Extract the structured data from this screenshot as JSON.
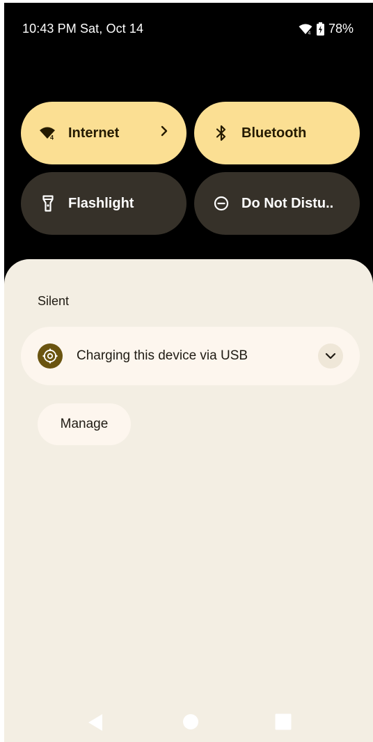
{
  "status_bar": {
    "time_date": "10:43 PM Sat, Oct 14",
    "battery_percent": "78%",
    "icons": [
      "wifi-icon",
      "battery-charging-icon"
    ]
  },
  "quick_settings": {
    "tiles": [
      {
        "label": "Internet",
        "icon": "wifi-icon",
        "state": "on",
        "has_chevron": true
      },
      {
        "label": "Bluetooth",
        "icon": "bluetooth-icon",
        "state": "on"
      },
      {
        "label": "Flashlight",
        "icon": "flashlight-icon",
        "state": "off"
      },
      {
        "label": "Do Not Distu..",
        "icon": "do-not-disturb-icon",
        "state": "off"
      }
    ]
  },
  "notifications": {
    "section_label": "Silent",
    "items": [
      {
        "title": "Charging this device via USB",
        "icon": "settings-gear-icon",
        "expand_icon": "chevron-down-icon"
      }
    ],
    "manage_label": "Manage"
  },
  "navigation": {
    "icons": [
      "back-icon",
      "home-icon",
      "recents-icon"
    ]
  },
  "colors": {
    "tile_on": "#fbdf93",
    "tile_off": "#363129",
    "shade_background": "#f3eee3",
    "notification_background": "#fdf6ee",
    "app_icon_background": "#6a5410"
  }
}
